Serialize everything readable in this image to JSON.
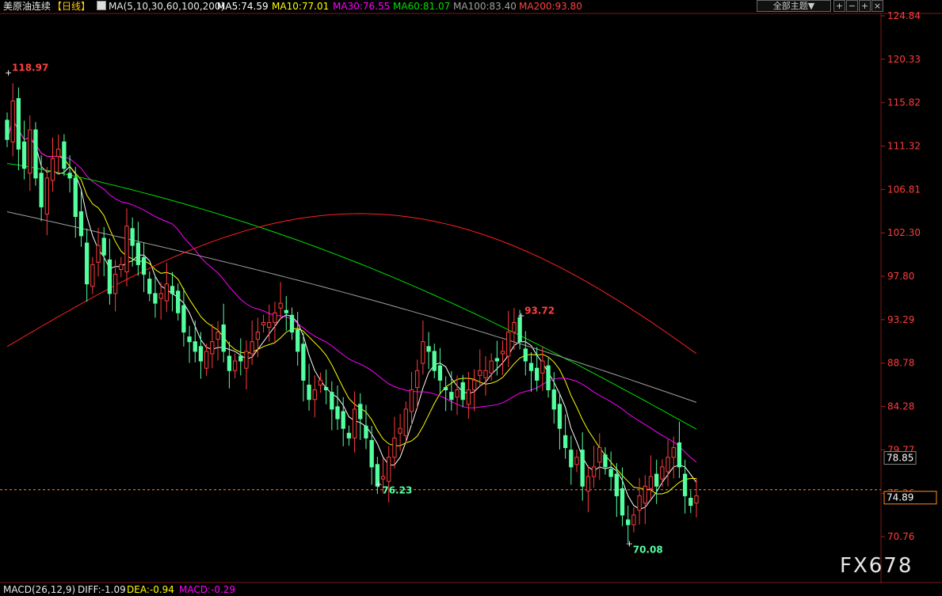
{
  "header": {
    "symbol": "美原油连续",
    "period": "【日线】",
    "ma_params": "MA(5,10,30,60,100,200)",
    "ma5": "MA5:74.59",
    "ma10": "MA10:77.01",
    "ma30": "MA30:76.55",
    "ma60": "MA60:81.07",
    "ma100": "MA100:83.40",
    "ma200": "MA200:93.80",
    "theme_dropdown": "全部主题▼",
    "btn_plus": "+",
    "btn_minus": "−",
    "btn_close": "×"
  },
  "macd": {
    "params": "MACD(26,12,9)",
    "diff": "DIFF:-1.09",
    "dea": "DEA:-0.94",
    "macd": "MACD:-0.29"
  },
  "watermark": "FX678",
  "colors": {
    "up": "#ff3c3c",
    "down": "#54ffa0",
    "ma5": "#ffffff",
    "ma10": "#ffff00",
    "ma30": "#ff00ff",
    "ma60": "#00e000",
    "ma100": "#a0a0a0",
    "ma200": "#ff2020"
  },
  "chart_data": {
    "type": "candlestick",
    "y_ticks": [
      "124.84",
      "120.33",
      "115.82",
      "111.32",
      "106.81",
      "102.30",
      "97.80",
      "93.29",
      "88.78",
      "84.28",
      "79.77",
      "75.26",
      "70.76"
    ],
    "ylim": [
      70.76,
      124.84
    ],
    "current_price": "74.89",
    "ref_price": "78.85",
    "annotations": [
      {
        "label": "118.97",
        "value": 118.97,
        "type": "high"
      },
      {
        "label": "93.72",
        "value": 93.72,
        "type": "high"
      },
      {
        "label": "76.23",
        "value": 76.23,
        "type": "low"
      },
      {
        "label": "70.08",
        "value": 70.08,
        "type": "low"
      }
    ],
    "close": [
      112,
      116,
      111,
      109,
      113,
      108,
      105,
      108,
      110,
      111,
      109,
      108,
      104,
      102,
      97,
      99,
      101,
      100,
      96,
      98,
      99,
      103,
      101,
      99,
      98,
      96,
      95,
      96,
      97,
      96,
      94,
      92,
      91,
      90,
      89,
      90,
      91,
      92,
      90,
      88,
      89,
      89,
      90,
      91,
      92,
      93,
      93,
      94,
      95,
      94,
      92,
      90,
      87,
      85,
      86,
      87,
      86,
      84,
      83,
      82,
      81,
      84,
      83,
      81,
      78,
      76,
      77,
      79,
      81,
      82,
      84,
      86,
      88,
      91,
      90,
      88,
      87,
      86,
      85,
      86,
      85,
      86,
      87,
      88,
      88,
      89,
      89,
      90,
      92,
      93,
      91,
      89,
      88,
      87,
      89,
      86,
      84,
      82,
      80,
      78,
      79,
      76,
      77,
      78,
      80,
      78,
      77,
      75,
      73,
      72,
      73,
      75,
      76,
      77,
      76,
      78,
      79,
      80,
      78,
      75,
      74,
      75
    ]
  }
}
